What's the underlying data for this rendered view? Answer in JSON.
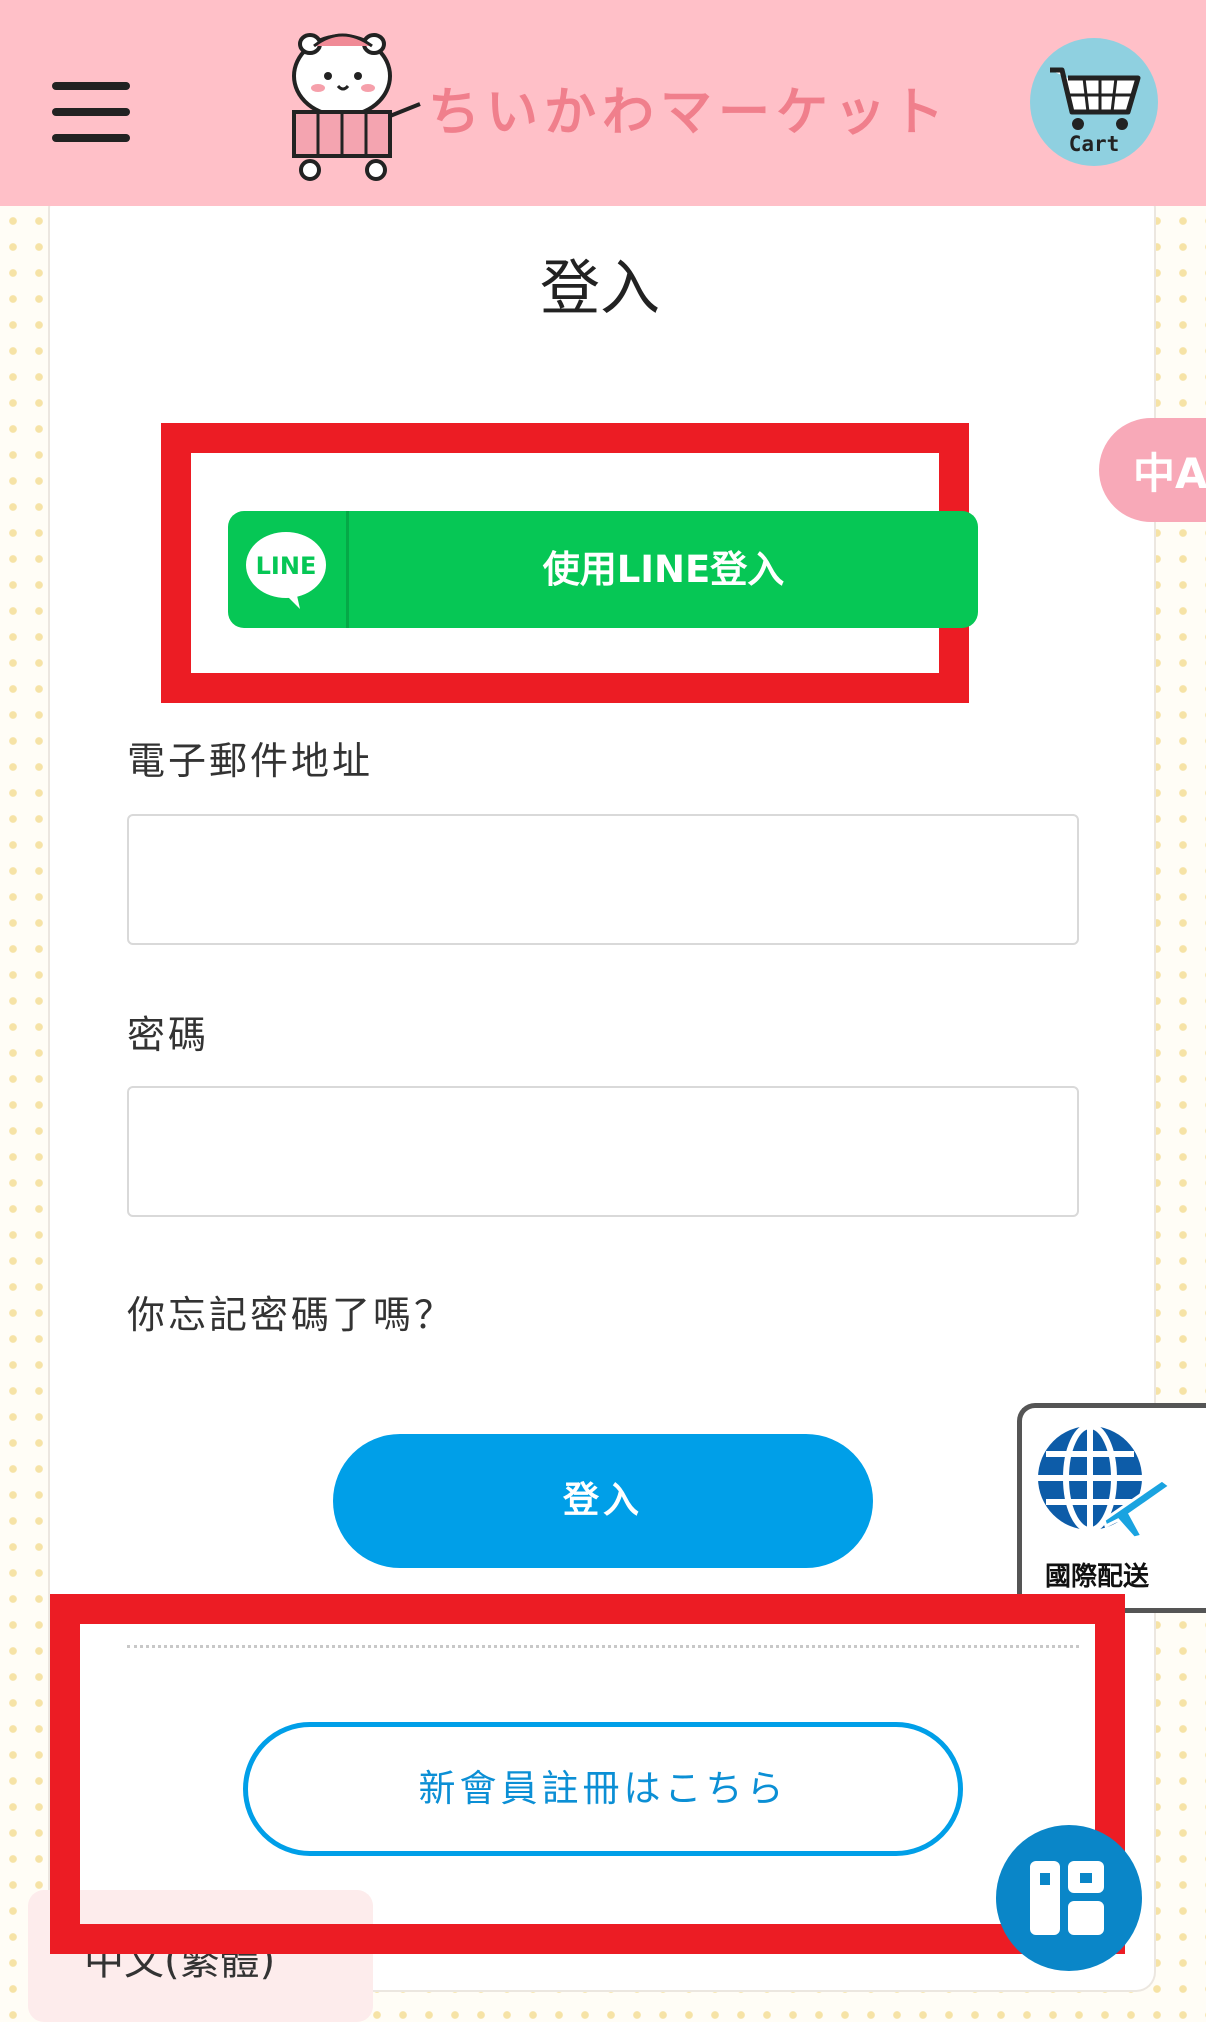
{
  "header": {
    "menu_icon": "hamburger-menu-icon",
    "logo_text": "ちいかわマーケット",
    "cart_label": "Cart"
  },
  "page": {
    "title": "登入",
    "line_login_label": "使用LINE登入",
    "line_icon_text": "LINE",
    "email_label": "電子郵件地址",
    "email_value": "",
    "password_label": "密碼",
    "password_value": "",
    "forgot_password": "你忘記密碼了嗎？",
    "login_button": "登入",
    "register_button": "新會員註冊はこちら"
  },
  "floating": {
    "translate_icon": "中A",
    "international_shipping_label": "國際配送",
    "language_selector": "中文(繁體)"
  },
  "colors": {
    "header_bg": "#ffc0c8",
    "line_green": "#06c755",
    "accent_blue": "#009fe8",
    "highlight_red": "#ec1c24"
  }
}
